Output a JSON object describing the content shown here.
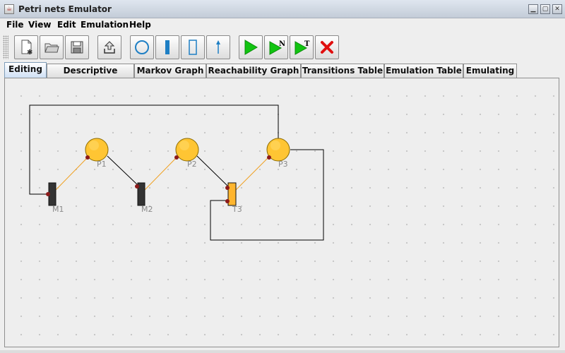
{
  "window": {
    "title": "Petri nets Emulator"
  },
  "menu": [
    "File",
    "View",
    "Edit",
    "Emulation",
    "Help"
  ],
  "toolbar": {
    "groups": [
      [
        "new-file-icon",
        "open-folder-icon",
        "save-disk-icon"
      ],
      [
        "export-upload-icon"
      ],
      [
        "place-circle-icon",
        "immediate-transition-icon",
        "timed-transition-icon",
        "arc-arrow-icon"
      ],
      [
        "run-emulation-icon",
        "run-n-steps-icon",
        "run-to-time-icon",
        "stop-emulation-icon"
      ]
    ],
    "run_n_letter": "N",
    "run_t_letter": "T"
  },
  "tabs": [
    {
      "label": "Editing",
      "active": true
    },
    {
      "label": "Descriptive Tables",
      "active": false
    },
    {
      "label": "Markov Graph",
      "active": false
    },
    {
      "label": "Reachability Graph",
      "active": false
    },
    {
      "label": "Transitions Table",
      "active": false
    },
    {
      "label": "Emulation Table",
      "active": false
    },
    {
      "label": "Emulating",
      "active": false
    }
  ],
  "net": {
    "places": [
      {
        "id": "P1",
        "label": "P1"
      },
      {
        "id": "P2",
        "label": "P2"
      },
      {
        "id": "P3",
        "label": "P3"
      }
    ],
    "transitions": [
      {
        "id": "M1",
        "label": "M1",
        "kind": "immediate"
      },
      {
        "id": "M2",
        "label": "M2",
        "kind": "immediate"
      },
      {
        "id": "T3",
        "label": "T3",
        "kind": "timed"
      }
    ]
  },
  "colors": {
    "place_fill": "#ffc533",
    "timed_transition_fill": "#ffb52e",
    "immediate_transition_fill": "#333333",
    "arc_orange": "#f0a020",
    "arc_black": "#000000",
    "arc_end": "#8b1a1a",
    "run_green": "#11c411",
    "stop_red": "#e01010"
  }
}
